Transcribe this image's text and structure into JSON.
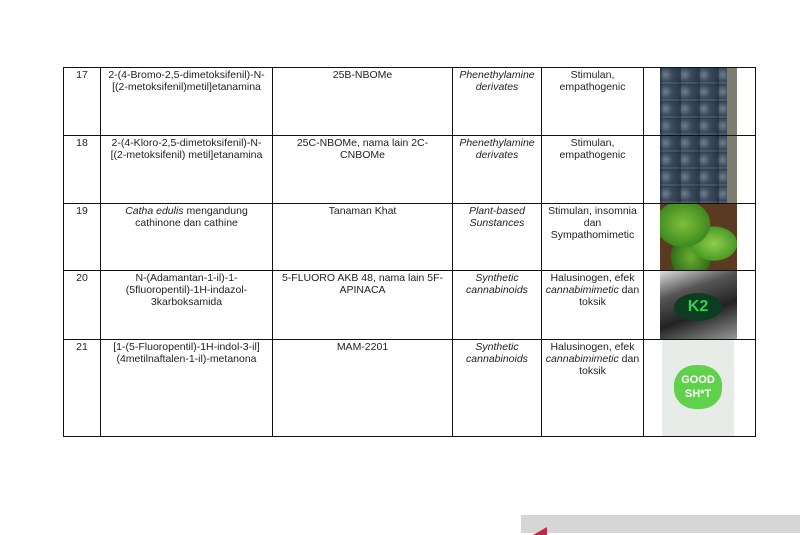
{
  "rows": [
    {
      "no": "17",
      "name": "2-(4-Bromo-2,5-dimetoksifenil)-N-[(2-metoksifenil)metil]etanamina",
      "alias": "25B-NBOMe",
      "group": "Phenethylamine derivates",
      "effect": "Stimulan, empathogenic",
      "image": "blister-pack-photo"
    },
    {
      "no": "18",
      "name": "2-(4-Kloro-2,5-dimetoksifenil)-N-[(2-metoksifenil) metil]etanamina",
      "alias": "25C-NBOMe, nama lain 2C-CNBOMe",
      "group": "Phenethylamine derivates",
      "effect": "Stimulan, empathogenic",
      "image": "blister-pack-photo"
    },
    {
      "no": "19",
      "name_italic": "Catha edulis",
      "name": " mengandung cathinone dan cathine",
      "alias": "Tanaman Khat",
      "group": "Plant-based Sunstances",
      "effect": "Stimulan, insomnia dan Sympathomimetic",
      "image": "khat-leaves-photo"
    },
    {
      "no": "20",
      "name": "N-(Adamantan-1-il)-1-(5fluoropentil)-1H-indazol-3karboksamida",
      "alias": "5-FLUORO AKB 48, nama lain 5F-APINACA",
      "group": "Synthetic cannabinoids",
      "effect_a": "Halusinogen, efek ",
      "effect_italic": "cannabimimetic",
      "effect_b": " dan toksik",
      "image": "k2-bag-photo",
      "logo_text": "K2"
    },
    {
      "no": "21",
      "name": "[1-(5-Fluoropentil)-1H-indol-3-il](4metilnaftalen-1-il)-metanona",
      "alias": "MAM-2201",
      "group": "Synthetic cannabinoids",
      "effect_a": "Halusinogen, efek ",
      "effect_italic": "cannabimimetic",
      "effect_b": " dan toksik",
      "image": "good-shit-pack-photo",
      "logo_text": "GOOD SH*T"
    }
  ],
  "watermark": "antaranews-logo"
}
